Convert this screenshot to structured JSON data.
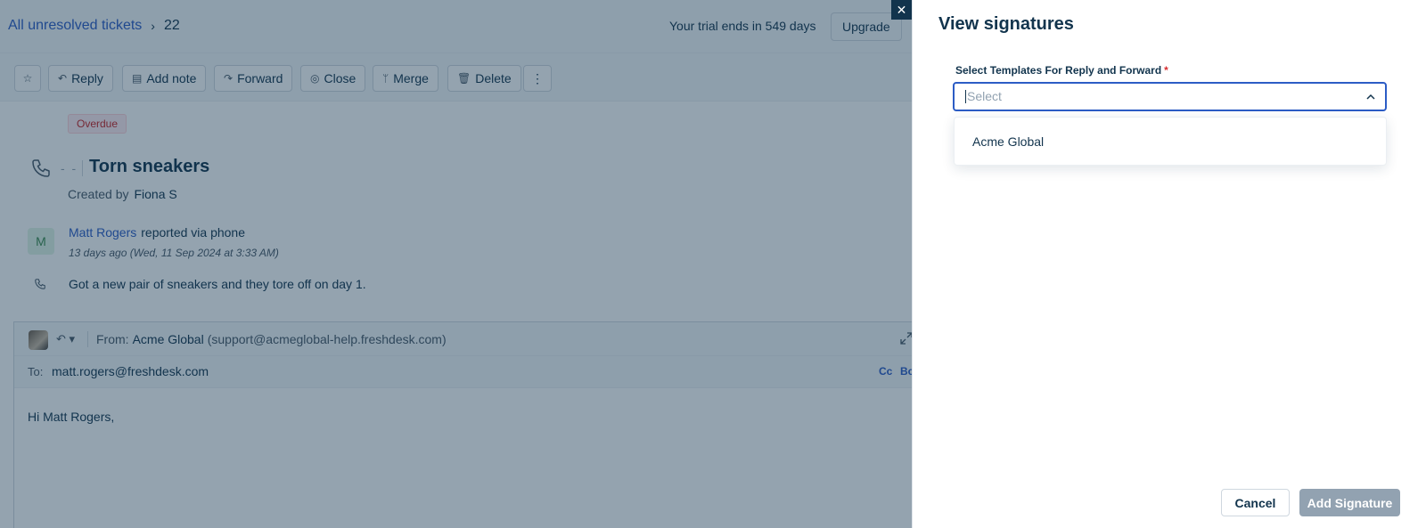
{
  "header": {
    "breadcrumb_link": "All unresolved tickets",
    "breadcrumb_current": "22",
    "trial_text": "Your trial ends in 549 days",
    "upgrade_label": "Upgrade"
  },
  "toolbar": {
    "reply": "Reply",
    "add_note": "Add note",
    "forward": "Forward",
    "close": "Close",
    "merge": "Merge",
    "delete": "Delete",
    "more": "⋮"
  },
  "ticket": {
    "status_badge": "Overdue",
    "dashes": "- -",
    "title": "Torn sneakers",
    "created_by_label": "Created by",
    "created_by_name": "Fiona S",
    "avatar_initial": "M",
    "reporter_name": "Matt Rogers",
    "reported_via": "reported via phone",
    "time_ago": "13 days ago (Wed, 11 Sep 2024 at 3:33 AM)",
    "message": "Got a new pair of sneakers and they tore off on day 1."
  },
  "reply": {
    "from_label": "From:",
    "from_name": "Acme Global",
    "from_email": "(support@acmeglobal-help.freshdesk.com)",
    "to_label": "To:",
    "to_value": "matt.rogers@freshdesk.com",
    "cc": "Cc",
    "bcc": "Bc",
    "greeting": "Hi Matt Rogers,"
  },
  "drawer": {
    "close_icon": "✕",
    "title": "View signatures",
    "field_label": "Select Templates For Reply and Forward",
    "required_mark": "*",
    "select_placeholder": "Select",
    "options": [
      "Acme Global"
    ],
    "cancel_label": "Cancel",
    "add_label": "Add Signature"
  },
  "colors": {
    "accent": "#2c5cc5",
    "text": "#12344d",
    "overlay": "#12344d",
    "disabled_button": "#92a2b1",
    "required": "#d72d30"
  }
}
